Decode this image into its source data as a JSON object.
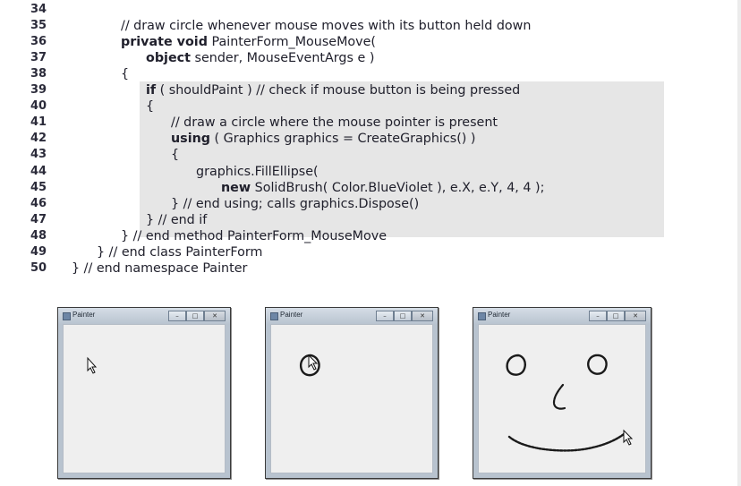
{
  "code": {
    "lines": [
      {
        "n": "34",
        "tokens": [
          {
            "t": ""
          }
        ]
      },
      {
        "n": "35",
        "tokens": [
          {
            "t": "// draw circle whenever mouse moves with its button held down"
          }
        ]
      },
      {
        "n": "36",
        "tokens": [
          {
            "t": "private void",
            "kw": true
          },
          {
            "t": " PainterForm_MouseMove("
          }
        ]
      },
      {
        "n": "37",
        "tokens": [
          {
            "t": "object",
            "kw": true
          },
          {
            "t": " sender, MouseEventArgs e )"
          }
        ]
      },
      {
        "n": "38",
        "tokens": [
          {
            "t": "{"
          }
        ]
      },
      {
        "n": "39",
        "tokens": [
          {
            "t": "if",
            "kw": true
          },
          {
            "t": " ( shouldPaint ) // check if mouse button is being pressed"
          }
        ]
      },
      {
        "n": "40",
        "tokens": [
          {
            "t": "{"
          }
        ]
      },
      {
        "n": "41",
        "tokens": [
          {
            "t": "// draw a circle where the mouse pointer is present"
          }
        ]
      },
      {
        "n": "42",
        "tokens": [
          {
            "t": "using",
            "kw": true
          },
          {
            "t": " ( Graphics graphics = CreateGraphics() )"
          }
        ]
      },
      {
        "n": "43",
        "tokens": [
          {
            "t": "{"
          }
        ]
      },
      {
        "n": "44",
        "tokens": [
          {
            "t": "graphics.FillEllipse("
          }
        ]
      },
      {
        "n": "45",
        "tokens": [
          {
            "t": "new",
            "kw": true
          },
          {
            "t": " SolidBrush( Color.BlueViolet ), e.X, e.Y, 4, 4 );"
          }
        ]
      },
      {
        "n": "46",
        "tokens": [
          {
            "t": "} // end using; calls graphics.Dispose()"
          }
        ]
      },
      {
        "n": "47",
        "tokens": [
          {
            "t": "} // end if"
          }
        ]
      },
      {
        "n": "48",
        "tokens": [
          {
            "t": "} // end method PainterForm_MouseMove"
          }
        ]
      },
      {
        "n": "49",
        "tokens": [
          {
            "t": "} // end class PainterForm"
          }
        ]
      },
      {
        "n": "50",
        "tokens": [
          {
            "t": "} // end namespace Painter"
          }
        ]
      }
    ]
  },
  "windows": [
    {
      "title": "Painter",
      "minimize_glyph": "–",
      "maximize_glyph": "□",
      "close_glyph": "✕",
      "drawing": "cursor-only"
    },
    {
      "title": "Painter",
      "minimize_glyph": "–",
      "maximize_glyph": "□",
      "close_glyph": "✕",
      "drawing": "single-circle"
    },
    {
      "title": "Painter",
      "minimize_glyph": "–",
      "maximize_glyph": "□",
      "close_glyph": "✕",
      "drawing": "smiley-face"
    }
  ],
  "colors": {
    "highlight": "#e6e6e6",
    "code_text": "#20202c",
    "ink": "#1a1a1a"
  }
}
